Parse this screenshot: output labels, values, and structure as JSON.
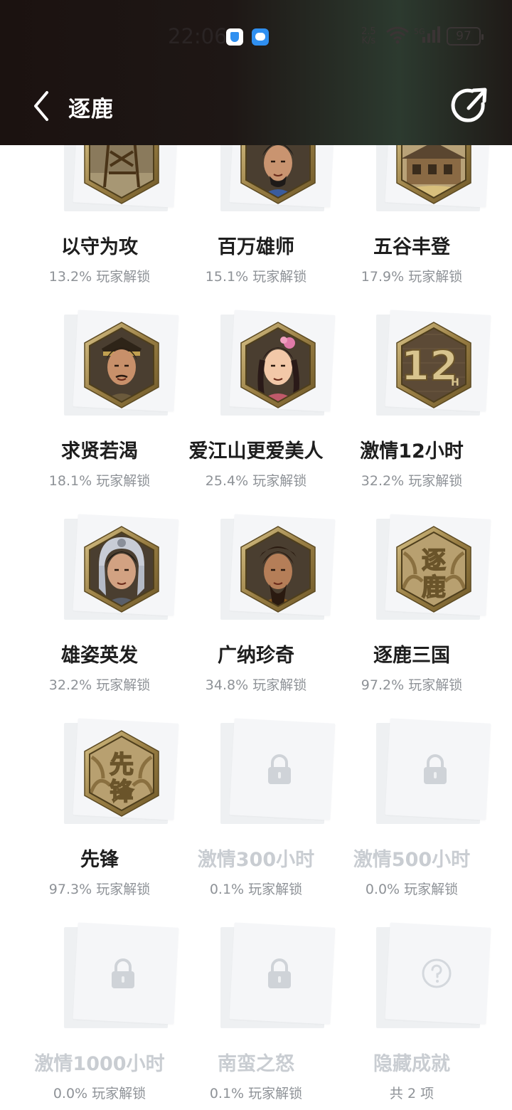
{
  "status_bar": {
    "time": "22:06",
    "net_speed_top": "2.5",
    "net_speed_bottom": "K/s",
    "signal_label": "5G",
    "battery": "97"
  },
  "header": {
    "title": "逐鹿",
    "back_icon": "chevron-left-icon",
    "share_icon": "share-external-icon"
  },
  "achievements": [
    {
      "name": "以守为攻",
      "rate": "13.2% 玩家解锁",
      "state": "unlocked",
      "art": "watchtower"
    },
    {
      "name": "百万雄师",
      "rate": "15.1% 玩家解锁",
      "state": "unlocked",
      "art": "general-blue"
    },
    {
      "name": "五谷丰登",
      "rate": "17.9% 玩家解锁",
      "state": "unlocked",
      "art": "granary"
    },
    {
      "name": "求贤若渴",
      "rate": "18.1% 玩家解锁",
      "state": "unlocked",
      "art": "scholar"
    },
    {
      "name": "爱江山更爱美人",
      "rate": "25.4% 玩家解锁",
      "state": "unlocked",
      "art": "lady"
    },
    {
      "name": "激情12小时",
      "rate": "32.2% 玩家解锁",
      "state": "unlocked",
      "art": "12h"
    },
    {
      "name": "雄姿英发",
      "rate": "32.2% 玩家解锁",
      "state": "unlocked",
      "art": "helmet-warrior"
    },
    {
      "name": "广纳珍奇",
      "rate": "34.8% 玩家解锁",
      "state": "unlocked",
      "art": "lord"
    },
    {
      "name": "逐鹿三国",
      "rate": "97.2% 玩家解锁",
      "state": "unlocked",
      "art": "zhulu-emblem"
    },
    {
      "name": "先锋",
      "rate": "97.3% 玩家解锁",
      "state": "unlocked",
      "art": "xianfeng-emblem"
    },
    {
      "name": "激情300小时",
      "rate": "0.1% 玩家解锁",
      "state": "locked",
      "art": "lock"
    },
    {
      "name": "激情500小时",
      "rate": "0.0% 玩家解锁",
      "state": "locked",
      "art": "lock"
    },
    {
      "name": "激情1000小时",
      "rate": "0.0% 玩家解锁",
      "state": "locked",
      "art": "lock"
    },
    {
      "name": "南蛮之怒",
      "rate": "0.1% 玩家解锁",
      "state": "locked",
      "art": "lock"
    },
    {
      "name": "隐藏成就",
      "rate": "共 2 项",
      "state": "hidden",
      "art": "question"
    }
  ],
  "badge_glyphs": {
    "12h_main": "12",
    "12h_sub": "H",
    "zhulu": "逐鹿",
    "xianfeng": "先锋"
  },
  "colors": {
    "header_bg": "#1b1210",
    "badge_frame": "#a38a52",
    "locked_text": "#c9cdd2",
    "rate_text": "#8e9297"
  }
}
